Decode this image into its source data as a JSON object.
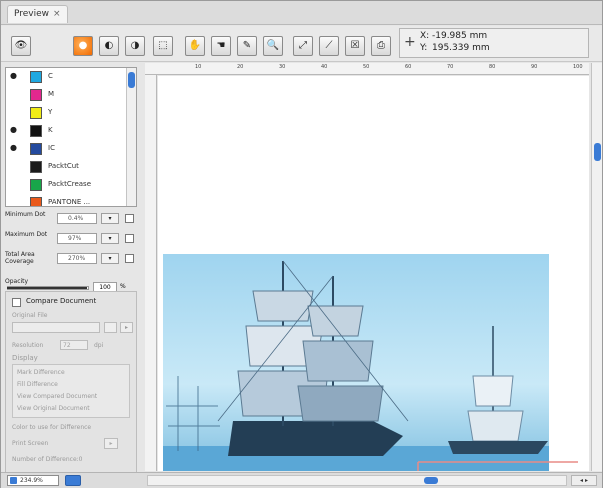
{
  "window": {
    "tab_label": "Preview",
    "tab_close": "×"
  },
  "toolbar": {
    "buttons": [
      {
        "name": "eye-toggle-button",
        "glyph": "👁"
      },
      {
        "name": "separation-color-button",
        "glyph": "●"
      },
      {
        "name": "half-tone-button",
        "glyph": "◐"
      },
      {
        "name": "half-mask-button",
        "glyph": "◑"
      },
      {
        "name": "area-select-button",
        "glyph": "⬚"
      },
      {
        "name": "hand-tool-button",
        "glyph": "✋"
      },
      {
        "name": "pan-tool-button",
        "glyph": "☚"
      },
      {
        "name": "eyedropper-button",
        "glyph": "✎"
      },
      {
        "name": "magnify-button",
        "glyph": "🔍"
      },
      {
        "name": "measure-button",
        "glyph": "⤢"
      },
      {
        "name": "ruler-button",
        "glyph": "⟋"
      },
      {
        "name": "close-view-button",
        "glyph": "☒"
      },
      {
        "name": "print-preview-button",
        "glyph": "⎙"
      }
    ],
    "coords": {
      "x_label": "X:",
      "y_label": "Y:",
      "x_value": "-19.985 mm",
      "y_value": "195.339 mm",
      "plus_glyph": "+"
    }
  },
  "separations": [
    {
      "name": "C",
      "color": "#1fa8e0",
      "visible": true
    },
    {
      "name": "M",
      "color": "#e2288e",
      "visible": false
    },
    {
      "name": "Y",
      "color": "#f1ec16",
      "visible": false
    },
    {
      "name": "K",
      "color": "#111111",
      "visible": true
    },
    {
      "name": "IC",
      "color": "#244a9e",
      "visible": true
    },
    {
      "name": "PacktCut",
      "color": "#1b1b1b",
      "visible": false
    },
    {
      "name": "PacktCrease",
      "color": "#18a64a",
      "visible": false
    },
    {
      "name": "PANTONE ...",
      "color": "#ea5a1c",
      "visible": false
    }
  ],
  "params": {
    "min_dot": {
      "label": "Minimum Dot",
      "value": "0.4%"
    },
    "max_dot": {
      "label": "Maximum Dot",
      "value": "97%"
    },
    "tac": {
      "label": "Total Area Coverage",
      "value": "270%"
    },
    "opacity": {
      "label": "Opacity",
      "value": "100",
      "unit": "%"
    }
  },
  "compare": {
    "title": "Compare Document",
    "original_file": "Original File",
    "resolution_label": "Resolution",
    "resolution_value": "72",
    "dpi": "dpi",
    "display": "Display",
    "display_items": [
      "Mark Difference",
      "Fill Difference",
      "View Compared Document",
      "View Original Document"
    ],
    "color_label": "Color to use for Difference",
    "print_label": "Print Screen",
    "num_diff_label": "Number of Difference:0"
  },
  "zoom": {
    "value": "234.9%"
  },
  "ruler": {
    "top_labels": [
      "10",
      "20",
      "30",
      "40",
      "50",
      "60",
      "70",
      "80",
      "90",
      "100"
    ]
  },
  "scroll_arrows": "◂ ▸"
}
